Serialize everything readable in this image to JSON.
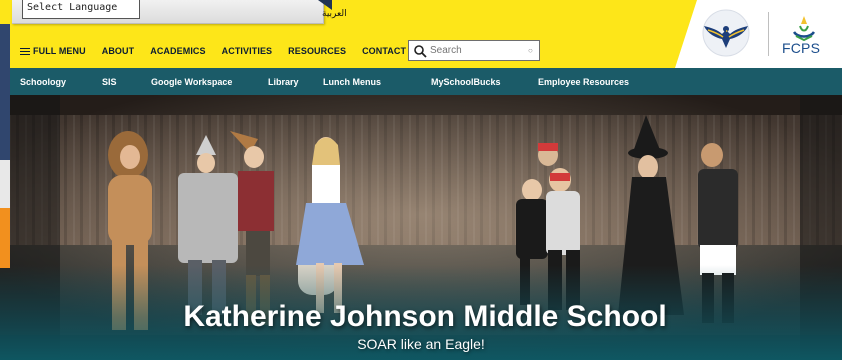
{
  "translate": {
    "selected": "Select Language",
    "arabic_label": "العربية"
  },
  "nav": {
    "menu_label": "FULL MENU",
    "items": [
      "ABOUT",
      "ACADEMICS",
      "ACTIVITIES",
      "RESOURCES",
      "CONTACT"
    ]
  },
  "search": {
    "placeholder": "Search"
  },
  "logos": {
    "fcps_label": "FCPS",
    "eagle_icon": "eagle-icon"
  },
  "quicklinks": [
    "Schoology",
    "SIS",
    "Google Workspace",
    "Library",
    "Lunch Menus",
    "MySchoolBucks",
    "Employee Resources"
  ],
  "hero": {
    "title": "Katherine Johnson Middle School",
    "subtitle": "SOAR like an Eagle!"
  },
  "colors": {
    "header_yellow": "#fde619",
    "quickbar_teal": "#1b5b68",
    "nav_text": "#0b1c33",
    "fcps_blue": "#1c4e8c"
  }
}
